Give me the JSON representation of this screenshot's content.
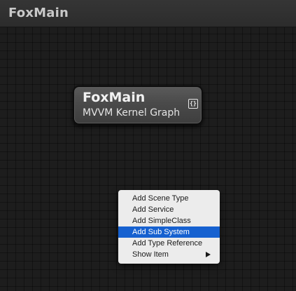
{
  "window": {
    "title": "FoxMain"
  },
  "node": {
    "title": "FoxMain",
    "subtitle": "MVVM Kernel Graph",
    "icon": "code-braces-icon"
  },
  "context_menu": {
    "items": [
      {
        "label": "Add Scene Type",
        "selected": false,
        "has_submenu": false
      },
      {
        "label": "Add Service",
        "selected": false,
        "has_submenu": false
      },
      {
        "label": "Add SimpleClass",
        "selected": false,
        "has_submenu": false
      },
      {
        "label": "Add Sub System",
        "selected": true,
        "has_submenu": false
      },
      {
        "label": "Add Type Reference",
        "selected": false,
        "has_submenu": false
      },
      {
        "label": "Show Item",
        "selected": false,
        "has_submenu": true
      }
    ],
    "selected_color": "#1661d0"
  },
  "colors": {
    "canvas_background": "#1d1d1d",
    "header_background": "#2c2c2c",
    "node_background": "#4a4a4a",
    "menu_background": "#ececec"
  }
}
